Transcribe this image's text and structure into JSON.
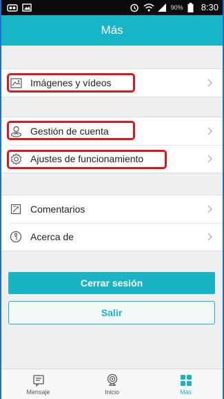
{
  "statusbar": {
    "battery_percent": "90%",
    "time": "8:30",
    "icons": [
      "app-notification-icon",
      "image-notification-icon",
      "alarm-icon",
      "wifi-icon",
      "signal-icon",
      "battery-icon"
    ]
  },
  "header": {
    "title": "Más"
  },
  "menu": {
    "group1": [
      {
        "label": "Imágenes y vídeos",
        "icon": "image-icon"
      }
    ],
    "group2": [
      {
        "label": "Gestión de cuenta",
        "icon": "account-icon"
      },
      {
        "label": "Ajustes de funcionamiento",
        "icon": "gear-icon"
      }
    ],
    "group3": [
      {
        "label": "Comentarios",
        "icon": "feedback-icon"
      },
      {
        "label": "Acerca de",
        "icon": "info-icon"
      }
    ]
  },
  "buttons": {
    "logout_label": "Cerrar sesión",
    "exit_label": "Salir"
  },
  "tabs": [
    {
      "label": "Mensaje",
      "icon": "message-icon",
      "active": false
    },
    {
      "label": "Inicio",
      "icon": "camera-icon",
      "active": false
    },
    {
      "label": "Más",
      "icon": "grid-icon",
      "active": true
    }
  ],
  "colors": {
    "accent": "#17b5c5",
    "highlight": "#e0141d",
    "statusbar": "#0c0c0c"
  }
}
